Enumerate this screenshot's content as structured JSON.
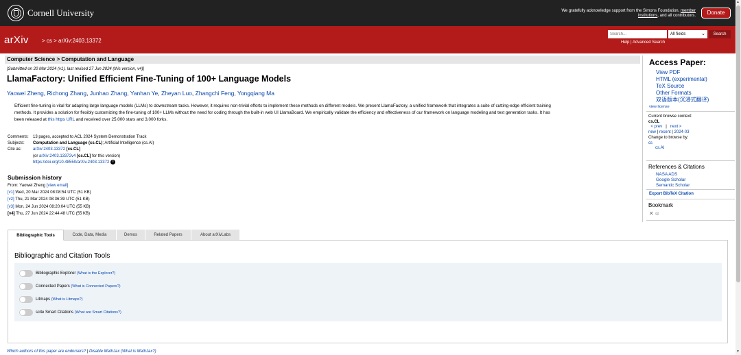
{
  "top_bar": {
    "university": "Cornell University",
    "support_line1_prefix": "We gratefully acknowledge support from the Simons Foundation,",
    "support_member": "member",
    "support_institutions": "institutions",
    "support_line2_suffix": ", and all contributors.",
    "donate": "Donate"
  },
  "header": {
    "logo": "arXiv",
    "breadcrumb": "> cs > arXiv:2403.13372",
    "search_placeholder": "Search...",
    "fields_value": "All fields",
    "search_button": "Search",
    "help": "Help",
    "advanced_search": "Advanced Search"
  },
  "subject_header": "Computer Science > Computation and Language",
  "paper": {
    "submitted": "[Submitted on 20 Mar 2024 (v1), last revised 27 Jun 2024 (this version, v4)]",
    "title": "LlamaFactory: Unified Efficient Fine-Tuning of 100+ Language Models",
    "authors": [
      "Yaowei Zheng",
      "Richong Zhang",
      "Junhao Zhang",
      "Yanhan Ye",
      "Zheyan Luo",
      "Zhangchi Feng",
      "Yongqiang Ma"
    ],
    "abstract_line1": "Efficient fine-tuning is vital for adapting large language models (LLMs) to downstream tasks. However, it requires non-trivial efforts to implement these methods on different models. We present LlamaFactory, a unified framework that integrates a suite of cutting-edge efficient training",
    "abstract_line2": "methods. It provides a solution for flexibly customizing the fine-tuning of 100+ LLMs without the need for coding through the built-in web UI LlamaBoard. We empirically validate the efficiency and effectiveness of our framework on language modeling and text generation tasks. It has",
    "abstract_line3_a": "been released at",
    "abstract_link": "this https URL",
    "abstract_line3_b": "and received over 25,000 stars and 3,000 forks."
  },
  "meta": {
    "comments_label": "Comments:",
    "comments": "13 pages, accepted to ACL 2024 System Demonstration Track",
    "subjects_label": "Subjects:",
    "subjects_primary": "Computation and Language (cs.CL)",
    "subjects_rest": "; Artificial Intelligence (cs.AI)",
    "cite_label": "Cite as:",
    "cite_id": "arXiv:2403.13372",
    "cite_cat": "[cs.CL]",
    "cite_or": "(or",
    "cite_version": "arXiv:2403.13372v4",
    "cite_version_suffix": "for this version)",
    "doi": "https://doi.org/10.48550/arXiv.2403.13372"
  },
  "history": {
    "title": "Submission history",
    "from_prefix": "From: Yaowei Zheng",
    "view_email": "[view email]",
    "versions": [
      {
        "v": "[v1]",
        "date": "Wed, 20 Mar 2024 08:08:54 UTC (51 KB)"
      },
      {
        "v": "[v2]",
        "date": "Thu, 21 Mar 2024 08:36:39 UTC (51 KB)"
      },
      {
        "v": "[v3]",
        "date": "Mon, 24 Jun 2024 08:20:04 UTC (55 KB)"
      },
      {
        "v": "[v4]",
        "date": "Thu, 27 Jun 2024 22:44:48 UTC (55 KB)"
      }
    ]
  },
  "sidebar": {
    "access_title": "Access Paper:",
    "links": [
      "View PDF",
      "HTML (experimental)",
      "TeX Source",
      "Other Formats",
      "双语版本(沉浸式翻译)"
    ],
    "view_license": "view license",
    "browse_context_label": "Current browse context:",
    "browse_context": "cs.CL",
    "prev": "< prev",
    "sep": "|",
    "next": "next >",
    "new": "new",
    "recent": "recent",
    "month": "2024-03",
    "change_browse": "Change to browse by:",
    "browse_cs": "cs",
    "browse_csai": "cs.AI",
    "refs_title": "References & Citations",
    "refs": [
      "NASA ADS",
      "Google Scholar",
      "Semantic Scholar"
    ],
    "bibtex": "Export BibTeX Citation",
    "bookmark_title": "Bookmark"
  },
  "tabs": [
    "Bibliographic Tools",
    "Code, Data, Media",
    "Demos",
    "Related Papers",
    "About arXivLabs"
  ],
  "panel": {
    "title": "Bibliographic and Citation Tools",
    "tools": [
      {
        "label": "Bibliographic Explorer",
        "link": "(What is the Explorer?)"
      },
      {
        "label": "Connected Papers",
        "link": "(What is Connected Papers?)"
      },
      {
        "label": "Litmaps",
        "link": "(What is Litmaps?)"
      },
      {
        "label": "scite Smart Citations",
        "link": "(What are Smart Citations?)"
      }
    ]
  },
  "footer": {
    "endorsers": "Which authors of this paper are endorsers?",
    "sep": "|",
    "disable_mathjax": "Disable MathJax",
    "what_mathjax": "(What is MathJax?)"
  }
}
